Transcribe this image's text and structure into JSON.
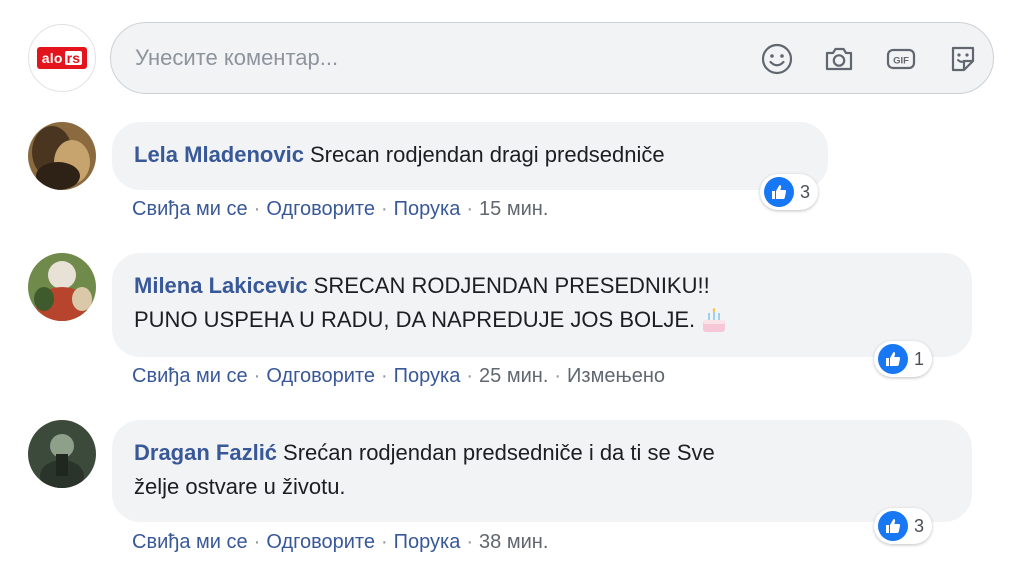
{
  "composer": {
    "page_logo_text": "alo",
    "page_logo_tld": "rs",
    "placeholder": "Унесите коментар..."
  },
  "icons": {
    "emoji": "smiley-icon",
    "camera": "camera-icon",
    "gif": "gif-icon",
    "sticker": "sticker-icon",
    "like": "thumbs-up-icon",
    "cake": "birthday-cake-icon"
  },
  "colors": {
    "link": "#385898",
    "like_badge": "#1877f2",
    "bubble": "#f2f3f5",
    "logo_red": "#e3141b"
  },
  "gif_label": "GIF",
  "comments": [
    {
      "author": "Lela Mladenovic",
      "line1": "Srecan rodjendan dragi predsedniče",
      "line2": "",
      "like": "Свиђа ми се",
      "reply": "Одговорите",
      "message": "Порука",
      "time": "15 мин.",
      "edited": "",
      "reactions": "3"
    },
    {
      "author": "Milena Lakicevic",
      "line1": "SRECAN RODJENDAN PRESEDNIKU!!",
      "line2": "PUNO USPEHA U RADU, DA NAPREDUJE JOS BOLJE.",
      "like": "Свиђа ми се",
      "reply": "Одговорите",
      "message": "Порука",
      "time": "25 мин.",
      "edited": "Измењено",
      "reactions": "1"
    },
    {
      "author": "Dragan Fazlić",
      "line1": "Srećan rodjendan predsedniče i da ti se Sve",
      "line2": "želje ostvare u životu.",
      "like": "Свиђа ми се",
      "reply": "Одговорите",
      "message": "Порука",
      "time": "38 мин.",
      "edited": "",
      "reactions": "3"
    }
  ],
  "separator": "·"
}
